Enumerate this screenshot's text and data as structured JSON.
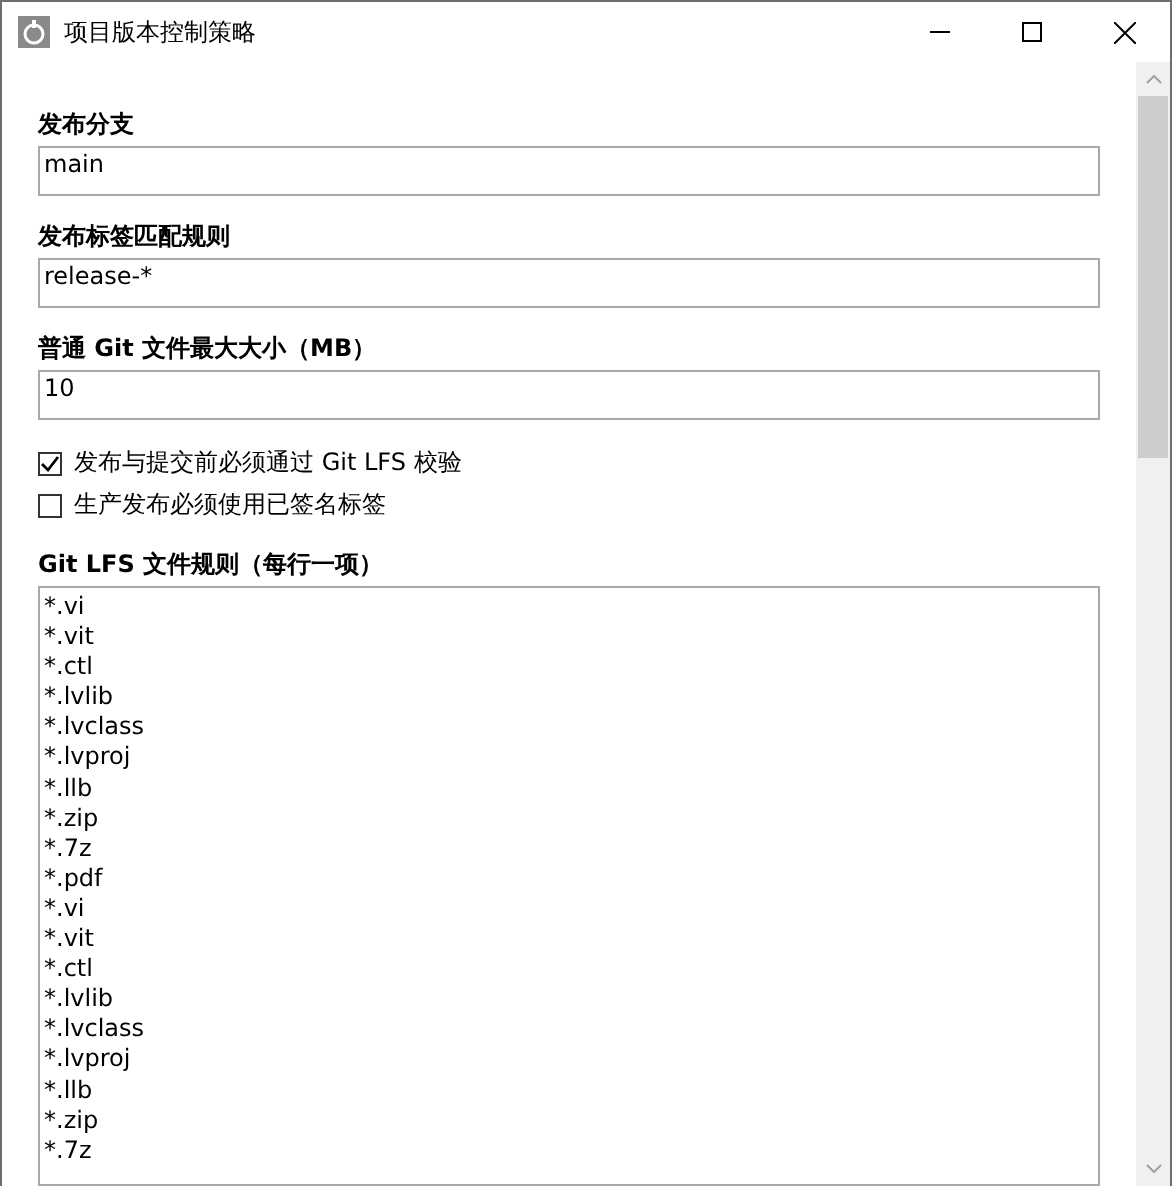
{
  "window": {
    "title": "项目版本控制策略"
  },
  "fields": [
    {
      "label": "发布分支",
      "value": "main"
    },
    {
      "label": "发布标签匹配规则",
      "value": "release-*"
    },
    {
      "label": "普通 Git 文件最大大小（MB）",
      "value": "10"
    }
  ],
  "checkboxes": [
    {
      "label": "发布与提交前必须通过 Git LFS 校验",
      "checked": true
    },
    {
      "label": "生产发布必须使用已签名标签",
      "checked": false
    }
  ],
  "lfs_rules": {
    "label": "Git LFS 文件规则（每行一项）",
    "lines": [
      "*.vi",
      "*.vit",
      "*.ctl",
      "*.lvlib",
      "*.lvclass",
      "*.lvproj",
      "*.llb",
      "*.zip",
      "*.7z",
      "*.pdf",
      "*.vi",
      "*.vit",
      "*.ctl",
      "*.lvlib",
      "*.lvclass",
      "*.lvproj",
      "*.llb",
      "*.zip",
      "*.7z"
    ]
  }
}
